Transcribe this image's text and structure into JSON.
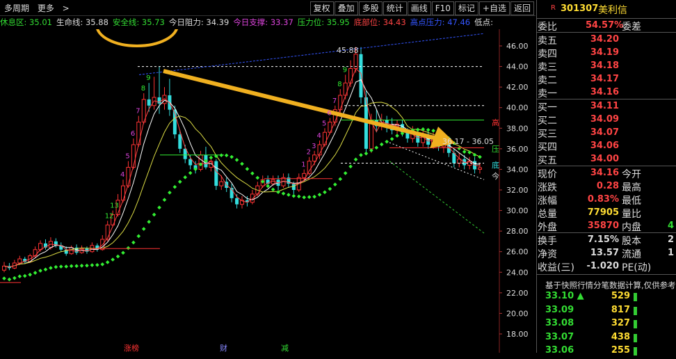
{
  "toolbar": {
    "period": "多周期",
    "more": "更多",
    "buttons": [
      "复权",
      "叠加",
      "多股",
      "统计",
      "画线",
      "F10",
      "标记",
      "+自选",
      "返回"
    ]
  },
  "indicators": [
    {
      "label": "休息区: 35.01",
      "color": "#33dd33"
    },
    {
      "label": "生命线: 35.88",
      "color": "#dddddd"
    },
    {
      "label": "安全线: 35.73",
      "color": "#33dd33"
    },
    {
      "label": "今日阻力: 34.39",
      "color": "#dddddd"
    },
    {
      "label": "今日支撑: 33.37",
      "color": "#dd44dd"
    },
    {
      "label": "压力位: 35.95",
      "color": "#33dd33"
    },
    {
      "label": "底部位: 34.43",
      "color": "#ff4444"
    },
    {
      "label": "高点压力: 47.46",
      "color": "#3355ff"
    },
    {
      "label": "低点:",
      "color": "#dddddd"
    }
  ],
  "chart_data": {
    "type": "line",
    "title": "",
    "ylim": [
      17,
      48
    ],
    "y_ticks": [
      "46.00",
      "44.00",
      "42.00",
      "40.00",
      "38.00",
      "36.00",
      "34.00",
      "32.00",
      "30.00",
      "28.00",
      "26.00",
      "24.00",
      "22.00",
      "20.00",
      "18.00"
    ],
    "candles": [
      {
        "o": 24.2,
        "c": 24.6,
        "h": 25.0,
        "l": 24.0
      },
      {
        "o": 24.6,
        "c": 24.4,
        "h": 24.9,
        "l": 24.2
      },
      {
        "o": 24.4,
        "c": 24.9,
        "h": 25.2,
        "l": 24.3
      },
      {
        "o": 24.9,
        "c": 25.3,
        "h": 25.6,
        "l": 24.7
      },
      {
        "o": 25.3,
        "c": 25.0,
        "h": 25.5,
        "l": 24.8
      },
      {
        "o": 25.0,
        "c": 25.6,
        "h": 25.8,
        "l": 24.9
      },
      {
        "o": 25.6,
        "c": 26.2,
        "h": 26.5,
        "l": 25.4
      },
      {
        "o": 26.2,
        "c": 26.8,
        "h": 27.1,
        "l": 26.0
      },
      {
        "o": 26.8,
        "c": 26.4,
        "h": 27.2,
        "l": 26.2
      },
      {
        "o": 26.4,
        "c": 27.0,
        "h": 27.4,
        "l": 26.2
      },
      {
        "o": 27.0,
        "c": 26.6,
        "h": 27.3,
        "l": 26.4
      },
      {
        "o": 26.6,
        "c": 26.2,
        "h": 26.9,
        "l": 26.0
      },
      {
        "o": 26.2,
        "c": 25.8,
        "h": 26.5,
        "l": 25.6
      },
      {
        "o": 25.8,
        "c": 26.4,
        "h": 26.6,
        "l": 25.7
      },
      {
        "o": 26.4,
        "c": 25.9,
        "h": 26.7,
        "l": 25.7
      },
      {
        "o": 25.9,
        "c": 26.3,
        "h": 26.6,
        "l": 25.8
      },
      {
        "o": 26.3,
        "c": 26.0,
        "h": 26.5,
        "l": 25.8
      },
      {
        "o": 26.0,
        "c": 26.6,
        "h": 26.9,
        "l": 25.9
      },
      {
        "o": 26.6,
        "c": 26.2,
        "h": 26.8,
        "l": 26.0
      },
      {
        "o": 26.2,
        "c": 27.2,
        "h": 27.6,
        "l": 26.1
      },
      {
        "o": 27.2,
        "c": 28.6,
        "h": 29.0,
        "l": 27.0
      },
      {
        "o": 28.6,
        "c": 29.6,
        "h": 30.0,
        "l": 28.4
      },
      {
        "o": 29.6,
        "c": 31.0,
        "h": 31.6,
        "l": 29.4
      },
      {
        "o": 31.0,
        "c": 32.4,
        "h": 33.0,
        "l": 30.8
      },
      {
        "o": 32.4,
        "c": 34.2,
        "h": 34.8,
        "l": 32.2
      },
      {
        "o": 34.2,
        "c": 36.4,
        "h": 37.0,
        "l": 34.0
      },
      {
        "o": 36.4,
        "c": 38.6,
        "h": 39.2,
        "l": 36.2
      },
      {
        "o": 38.6,
        "c": 40.8,
        "h": 41.4,
        "l": 38.4
      },
      {
        "o": 40.8,
        "c": 40.2,
        "h": 42.4,
        "l": 39.6
      },
      {
        "o": 40.2,
        "c": 41.0,
        "h": 43.0,
        "l": 39.8
      },
      {
        "o": 41.0,
        "c": 40.4,
        "h": 44.0,
        "l": 39.4
      },
      {
        "o": 40.4,
        "c": 41.2,
        "h": 42.0,
        "l": 39.8
      },
      {
        "o": 41.2,
        "c": 39.8,
        "h": 42.8,
        "l": 39.2
      },
      {
        "o": 39.8,
        "c": 37.4,
        "h": 40.2,
        "l": 37.0
      },
      {
        "o": 37.4,
        "c": 36.0,
        "h": 37.8,
        "l": 35.6
      },
      {
        "o": 36.0,
        "c": 35.0,
        "h": 36.4,
        "l": 34.6
      },
      {
        "o": 35.0,
        "c": 34.4,
        "h": 35.4,
        "l": 34.0
      },
      {
        "o": 34.4,
        "c": 34.0,
        "h": 34.8,
        "l": 33.6
      },
      {
        "o": 34.0,
        "c": 35.4,
        "h": 35.8,
        "l": 33.8
      },
      {
        "o": 35.4,
        "c": 34.2,
        "h": 36.2,
        "l": 34.0
      },
      {
        "o": 34.2,
        "c": 34.8,
        "h": 35.2,
        "l": 33.8
      },
      {
        "o": 34.8,
        "c": 32.4,
        "h": 35.0,
        "l": 32.0
      },
      {
        "o": 32.4,
        "c": 32.8,
        "h": 33.4,
        "l": 32.0
      },
      {
        "o": 32.8,
        "c": 32.2,
        "h": 33.2,
        "l": 31.8
      },
      {
        "o": 32.2,
        "c": 31.2,
        "h": 32.6,
        "l": 30.8
      },
      {
        "o": 31.2,
        "c": 30.6,
        "h": 31.6,
        "l": 30.2
      },
      {
        "o": 30.6,
        "c": 31.0,
        "h": 31.4,
        "l": 30.2
      },
      {
        "o": 31.0,
        "c": 30.8,
        "h": 31.4,
        "l": 30.4
      },
      {
        "o": 30.8,
        "c": 31.6,
        "h": 32.0,
        "l": 30.6
      },
      {
        "o": 31.6,
        "c": 32.4,
        "h": 32.8,
        "l": 31.4
      },
      {
        "o": 32.4,
        "c": 33.0,
        "h": 33.4,
        "l": 32.2
      },
      {
        "o": 33.0,
        "c": 32.6,
        "h": 33.4,
        "l": 32.2
      },
      {
        "o": 32.6,
        "c": 33.0,
        "h": 33.4,
        "l": 32.4
      },
      {
        "o": 33.0,
        "c": 32.4,
        "h": 33.4,
        "l": 32.0
      },
      {
        "o": 32.4,
        "c": 33.2,
        "h": 33.6,
        "l": 32.2
      },
      {
        "o": 33.2,
        "c": 32.6,
        "h": 33.6,
        "l": 32.2
      },
      {
        "o": 32.6,
        "c": 32.0,
        "h": 32.8,
        "l": 31.6
      },
      {
        "o": 32.0,
        "c": 33.2,
        "h": 33.6,
        "l": 31.8
      },
      {
        "o": 33.2,
        "c": 33.6,
        "h": 34.0,
        "l": 32.8
      },
      {
        "o": 33.6,
        "c": 34.8,
        "h": 35.2,
        "l": 33.4
      },
      {
        "o": 34.8,
        "c": 35.4,
        "h": 35.8,
        "l": 34.4
      },
      {
        "o": 35.4,
        "c": 36.4,
        "h": 36.8,
        "l": 35.0
      },
      {
        "o": 36.4,
        "c": 37.6,
        "h": 38.0,
        "l": 36.2
      },
      {
        "o": 37.6,
        "c": 38.6,
        "h": 39.0,
        "l": 37.4
      },
      {
        "o": 38.6,
        "c": 39.8,
        "h": 40.2,
        "l": 38.2
      },
      {
        "o": 39.8,
        "c": 41.2,
        "h": 41.8,
        "l": 39.4
      },
      {
        "o": 41.2,
        "c": 42.4,
        "h": 43.2,
        "l": 40.8
      },
      {
        "o": 42.4,
        "c": 43.8,
        "h": 44.6,
        "l": 42.0
      },
      {
        "o": 43.8,
        "c": 45.2,
        "h": 45.9,
        "l": 43.4
      },
      {
        "o": 45.2,
        "c": 41.0,
        "h": 45.88,
        "l": 40.4
      },
      {
        "o": 41.0,
        "c": 36.0,
        "h": 41.6,
        "l": 35.4
      },
      {
        "o": 36.0,
        "c": 38.8,
        "h": 39.4,
        "l": 35.6
      },
      {
        "o": 38.8,
        "c": 38.2,
        "h": 39.8,
        "l": 37.6
      },
      {
        "o": 38.2,
        "c": 38.8,
        "h": 39.4,
        "l": 37.8
      },
      {
        "o": 38.8,
        "c": 38.4,
        "h": 39.2,
        "l": 37.6
      },
      {
        "o": 38.4,
        "c": 37.8,
        "h": 39.0,
        "l": 37.4
      },
      {
        "o": 37.8,
        "c": 38.4,
        "h": 38.8,
        "l": 37.2
      },
      {
        "o": 38.4,
        "c": 37.6,
        "h": 38.8,
        "l": 37.2
      },
      {
        "o": 37.6,
        "c": 37.0,
        "h": 38.0,
        "l": 36.6
      },
      {
        "o": 37.0,
        "c": 37.6,
        "h": 38.2,
        "l": 36.6
      },
      {
        "o": 37.6,
        "c": 36.6,
        "h": 38.0,
        "l": 36.2
      },
      {
        "o": 36.6,
        "c": 37.2,
        "h": 37.8,
        "l": 36.2
      },
      {
        "o": 37.2,
        "c": 36.4,
        "h": 37.8,
        "l": 36.0
      },
      {
        "o": 36.4,
        "c": 37.0,
        "h": 37.6,
        "l": 36.0
      },
      {
        "o": 37.0,
        "c": 36.2,
        "h": 37.6,
        "l": 35.8
      },
      {
        "o": 36.2,
        "c": 36.6,
        "h": 37.0,
        "l": 35.6
      },
      {
        "o": 36.6,
        "c": 35.6,
        "h": 37.2,
        "l": 35.2
      },
      {
        "o": 35.6,
        "c": 34.6,
        "h": 36.0,
        "l": 34.2
      },
      {
        "o": 34.6,
        "c": 35.0,
        "h": 35.6,
        "l": 34.2
      },
      {
        "o": 35.0,
        "c": 34.4,
        "h": 35.4,
        "l": 34.0
      },
      {
        "o": 34.4,
        "c": 34.8,
        "h": 35.2,
        "l": 34.0
      },
      {
        "o": 34.8,
        "c": 34.0,
        "h": 35.2,
        "l": 33.6
      },
      {
        "o": 34.0,
        "c": 34.16,
        "h": 34.6,
        "l": 33.6
      }
    ],
    "annotations": [
      "45.88",
      "36.17 - 36.05",
      "涨榜",
      "财",
      "减",
      "高",
      "压",
      "底",
      "今"
    ],
    "markers": [
      {
        "t": "9",
        "i": 28
      },
      {
        "t": "8",
        "i": 27
      },
      {
        "t": "7",
        "i": 26
      },
      {
        "t": "6",
        "i": 25
      },
      {
        "t": "5",
        "i": 24
      },
      {
        "t": "4",
        "i": 23
      },
      {
        "t": "13",
        "i": 21
      },
      {
        "t": "12",
        "i": 20
      },
      {
        "t": "9",
        "i": 66
      },
      {
        "t": "8",
        "i": 65
      },
      {
        "t": "7",
        "i": 64
      },
      {
        "t": "6",
        "i": 63
      },
      {
        "t": "5",
        "i": 62
      },
      {
        "t": "4",
        "i": 61
      },
      {
        "t": "3",
        "i": 60
      },
      {
        "t": "2",
        "i": 59
      },
      {
        "t": "1",
        "i": 58
      }
    ]
  },
  "quote": {
    "code": "301307",
    "name": "美利信",
    "badge": "R",
    "weibi_label": "委比",
    "weibi_value": "54.57%",
    "weicha_label": "委差",
    "asks": [
      {
        "label": "卖五",
        "price": "34.20"
      },
      {
        "label": "卖四",
        "price": "34.19"
      },
      {
        "label": "卖三",
        "price": "34.18"
      },
      {
        "label": "卖二",
        "price": "34.17"
      },
      {
        "label": "卖一",
        "price": "34.16"
      }
    ],
    "bids": [
      {
        "label": "买一",
        "price": "34.11"
      },
      {
        "label": "买二",
        "price": "34.09"
      },
      {
        "label": "买三",
        "price": "34.07"
      },
      {
        "label": "买四",
        "price": "34.06"
      },
      {
        "label": "买五",
        "price": "34.00"
      }
    ],
    "stats": [
      {
        "l": "现价",
        "v": "34.16",
        "vcolor": "#ff4444",
        "l2": "今开"
      },
      {
        "l": "涨跌",
        "v": "0.28",
        "vcolor": "#ff4444",
        "l2": "最高"
      },
      {
        "l": "涨幅",
        "v": "0.83%",
        "vcolor": "#ff4444",
        "l2": "最低"
      },
      {
        "l": "总量",
        "v": "77905",
        "vcolor": "#ffdd33",
        "l2": "量比"
      },
      {
        "l": "外盘",
        "v": "35870",
        "vcolor": "#ff4444",
        "l2": "内盘",
        "v3": "4",
        "v3color": "#33dd33"
      }
    ],
    "stats2": [
      {
        "l": "换手",
        "v": "7.15%",
        "vcolor": "#dddddd",
        "l2": "股本",
        "v3": "2"
      },
      {
        "l": "净资",
        "v": "13.57",
        "vcolor": "#dddddd",
        "l2": "流通",
        "v3": "1"
      },
      {
        "l": "收益(三)",
        "v": "-1.020",
        "vcolor": "#dddddd",
        "l2": "PE(动)"
      }
    ],
    "note": "基于快照行情分笔数据计算,仅供参考",
    "ticks": [
      {
        "p": "33.10",
        "q": "529",
        "arrow": "▲"
      },
      {
        "p": "33.09",
        "q": "817"
      },
      {
        "p": "33.08",
        "q": "327"
      },
      {
        "p": "33.07",
        "q": "438"
      },
      {
        "p": "33.06",
        "q": "255"
      }
    ]
  }
}
